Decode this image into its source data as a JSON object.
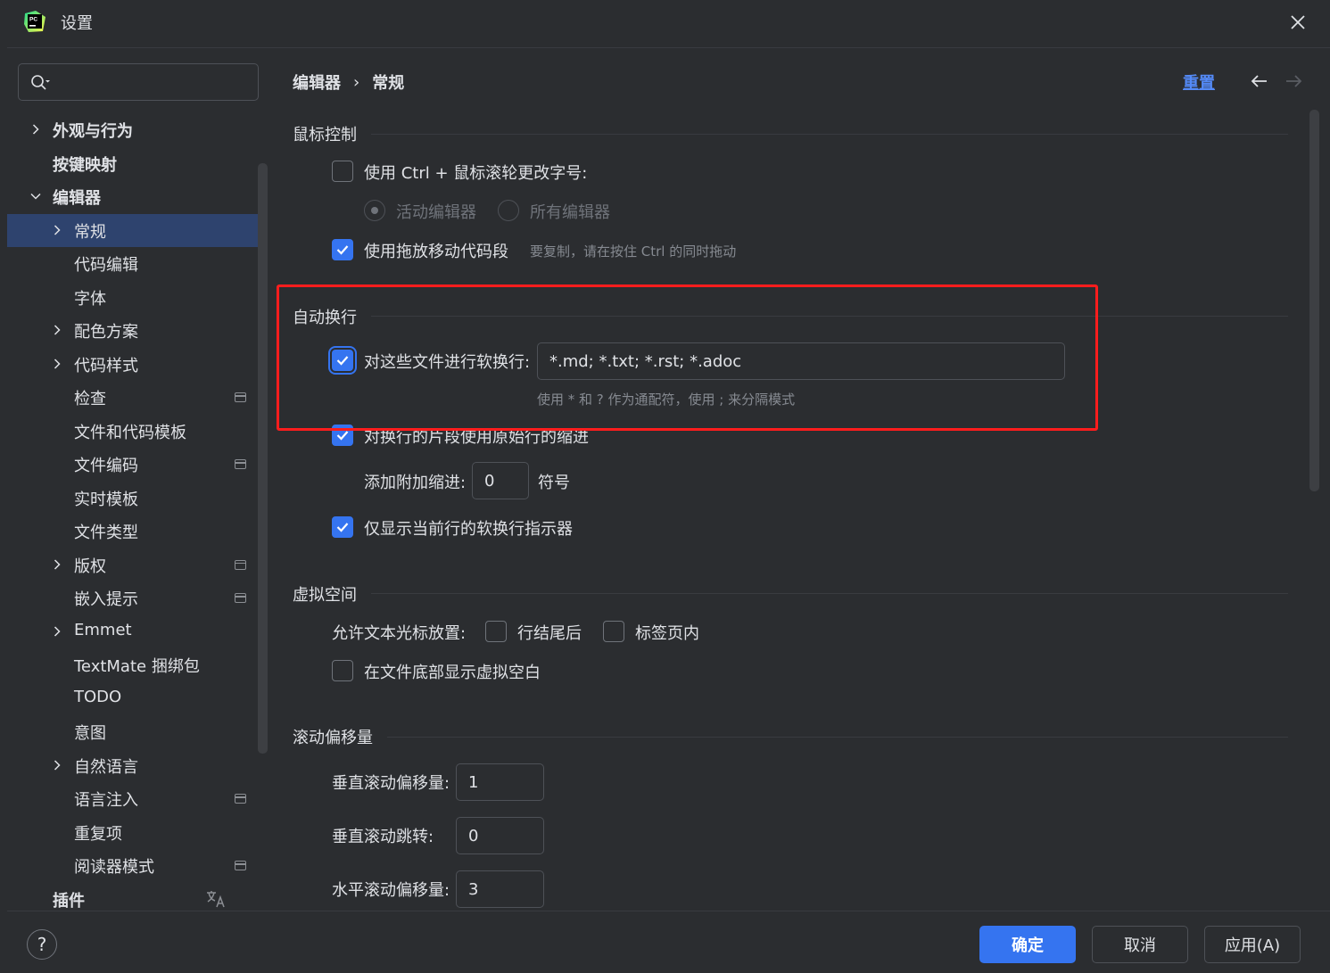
{
  "window": {
    "title": "设置"
  },
  "sidebar": {
    "search_placeholder": "",
    "items": [
      {
        "label": "外观与行为",
        "level": 0,
        "expandable": true,
        "expanded": false,
        "bold": true
      },
      {
        "label": "按键映射",
        "level": 0,
        "expandable": false,
        "bold": true
      },
      {
        "label": "编辑器",
        "level": 0,
        "expandable": true,
        "expanded": true,
        "bold": true
      },
      {
        "label": "常规",
        "level": 1,
        "expandable": true,
        "selected": true
      },
      {
        "label": "代码编辑",
        "level": 1
      },
      {
        "label": "字体",
        "level": 1
      },
      {
        "label": "配色方案",
        "level": 1,
        "expandable": true
      },
      {
        "label": "代码样式",
        "level": 1,
        "expandable": true
      },
      {
        "label": "检查",
        "level": 1,
        "badge": true
      },
      {
        "label": "文件和代码模板",
        "level": 1
      },
      {
        "label": "文件编码",
        "level": 1,
        "badge": true
      },
      {
        "label": "实时模板",
        "level": 1
      },
      {
        "label": "文件类型",
        "level": 1
      },
      {
        "label": "版权",
        "level": 1,
        "expandable": true,
        "badge": true
      },
      {
        "label": "嵌入提示",
        "level": 1,
        "badge": true
      },
      {
        "label": "Emmet",
        "level": 1,
        "expandable": true
      },
      {
        "label": "TextMate 捆绑包",
        "level": 1
      },
      {
        "label": "TODO",
        "level": 1
      },
      {
        "label": "意图",
        "level": 1
      },
      {
        "label": "自然语言",
        "level": 1,
        "expandable": true
      },
      {
        "label": "语言注入",
        "level": 1,
        "badge": true
      },
      {
        "label": "重复项",
        "level": 1
      },
      {
        "label": "阅读器模式",
        "level": 1,
        "badge": true
      },
      {
        "label": "插件",
        "level": 0,
        "bold": true,
        "translate_icon": true
      }
    ]
  },
  "main": {
    "breadcrumb": [
      "编辑器",
      "常规"
    ],
    "breadcrumb_sep": "›",
    "reset_label": "重置",
    "mouse": {
      "title": "鼠标控制",
      "ctrl_wheel": {
        "label": "使用 Ctrl + 鼠标滚轮更改字号:",
        "checked": false
      },
      "radio_active": {
        "label": "活动编辑器",
        "checked": true
      },
      "radio_all": {
        "label": "所有编辑器",
        "checked": false
      },
      "drag_drop": {
        "label": "使用拖放移动代码段",
        "checked": true
      },
      "drag_hint": "要复制，请在按住 Ctrl 的同时拖动"
    },
    "soft_wrap": {
      "title": "自动换行",
      "files": {
        "label": "对这些文件进行软换行:",
        "checked": true,
        "value": "*.md; *.txt; *.rst; *.adoc"
      },
      "files_hint": "使用 * 和 ? 作为通配符，使用 ; 来分隔模式",
      "indent": {
        "label": "对换行的片段使用原始行的缩进",
        "checked": true
      },
      "extra_indent": {
        "label": "添加附加缩进:",
        "value": "0",
        "unit": "符号"
      },
      "current_line": {
        "label": "仅显示当前行的软换行指示器",
        "checked": true
      }
    },
    "virtual": {
      "title": "虚拟空间",
      "caret_label": "允许文本光标放置:",
      "after_eol": {
        "label": "行结尾后",
        "checked": false
      },
      "inside_tabs": {
        "label": "标签页内",
        "checked": false
      },
      "bottom": {
        "label": "在文件底部显示虚拟空白",
        "checked": false
      }
    },
    "scroll": {
      "title": "滚动偏移量",
      "vertical_offset": {
        "label": "垂直滚动偏移量:",
        "value": "1"
      },
      "vertical_jump": {
        "label": "垂直滚动跳转:",
        "value": "0"
      },
      "horizontal_offset": {
        "label": "水平滚动偏移量:",
        "value": "3"
      }
    }
  },
  "footer": {
    "help": "?",
    "ok": "确定",
    "cancel": "取消",
    "apply": "应用(A)"
  },
  "colors": {
    "accent": "#3574f0",
    "selection": "#2e436e",
    "highlight": "#ff1d1d",
    "link": "#548af7"
  }
}
